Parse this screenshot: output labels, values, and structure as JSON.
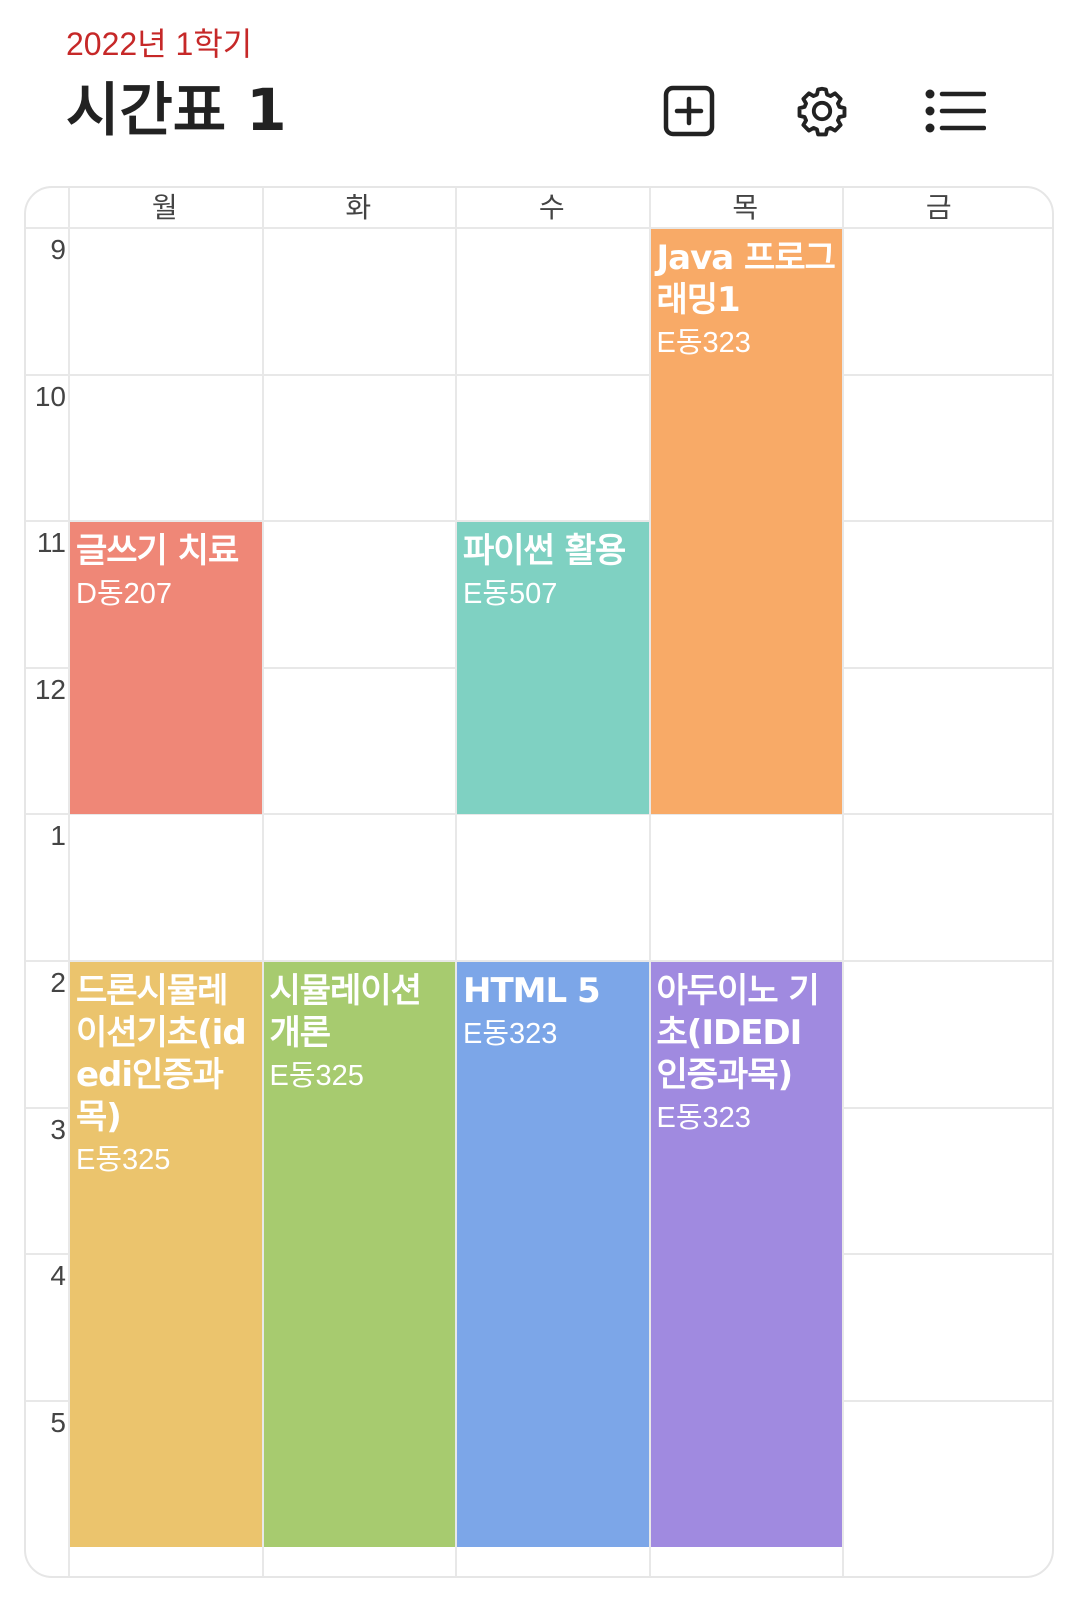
{
  "header": {
    "semester": "2022년 1학기",
    "title": "시간표 1",
    "add_icon": "add-square-icon",
    "settings_icon": "gear-icon",
    "list_icon": "list-icon"
  },
  "days": [
    "월",
    "화",
    "수",
    "목",
    "금"
  ],
  "hours": [
    "9",
    "10",
    "11",
    "12",
    "1",
    "2",
    "3",
    "4",
    "5"
  ],
  "courses": [
    {
      "name": "Java 프로그래밍1",
      "room": "E동323",
      "day": 3,
      "start_hour_index": 0,
      "duration_hours": 4,
      "color": "#f8aa67"
    },
    {
      "name": "글쓰기 치료",
      "room": "D동207",
      "day": 0,
      "start_hour_index": 2,
      "duration_hours": 2,
      "color": "#ef8777"
    },
    {
      "name": "파이썬 활용",
      "room": "E동507",
      "day": 2,
      "start_hour_index": 2,
      "duration_hours": 2,
      "color": "#7fd1c2"
    },
    {
      "name": "드론시뮬레이션기초(idedi인증과목)",
      "room": "E동325",
      "day": 0,
      "start_hour_index": 5,
      "duration_hours": 4,
      "color": "#ebc46d"
    },
    {
      "name": "시뮬레이션 개론",
      "room": "E동325",
      "day": 1,
      "start_hour_index": 5,
      "duration_hours": 4,
      "color": "#a7cb6f"
    },
    {
      "name": "HTML 5",
      "room": "E동323",
      "day": 2,
      "start_hour_index": 5,
      "duration_hours": 4,
      "color": "#7ca6e8"
    },
    {
      "name": "아두이노 기초(IDEDI 인증과목)",
      "room": "E동323",
      "day": 3,
      "start_hour_index": 5,
      "duration_hours": 4,
      "color": "#a08ae0"
    }
  ]
}
